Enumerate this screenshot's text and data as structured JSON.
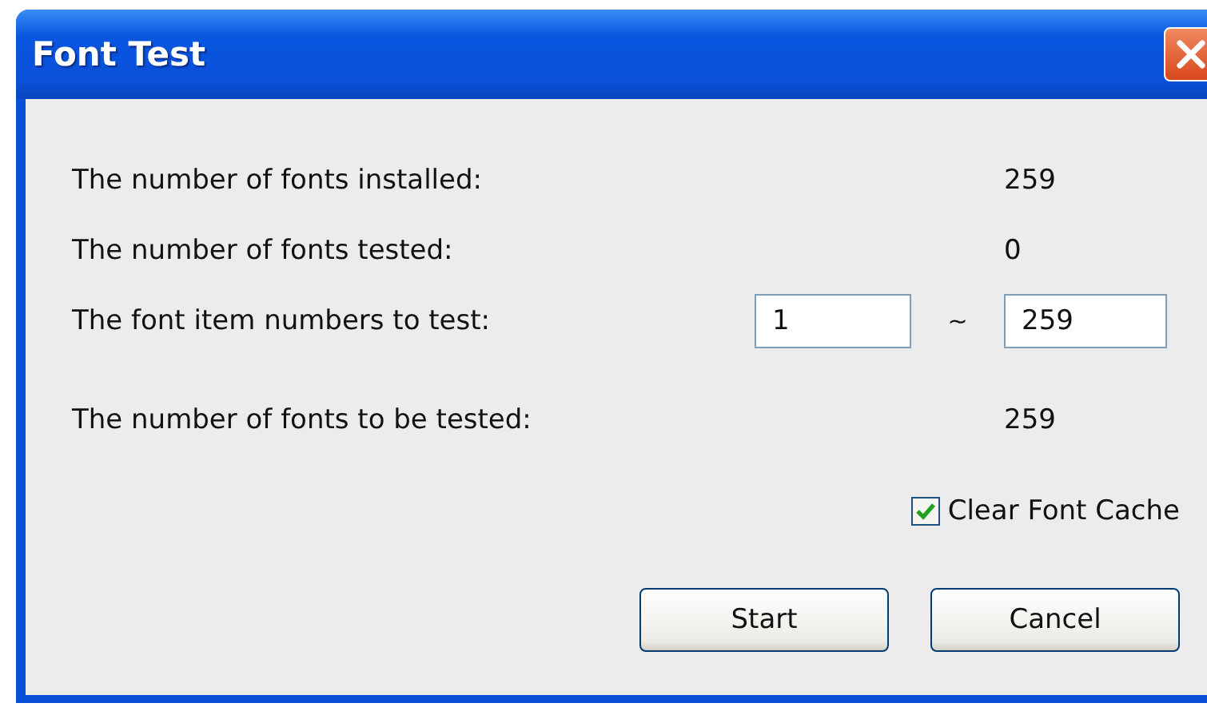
{
  "window": {
    "title": "Font Test"
  },
  "rows": [
    {
      "kind": "value",
      "label": "The number of fonts installed:",
      "value": "259"
    },
    {
      "kind": "value",
      "label": "The number of fonts tested:",
      "value": "0"
    },
    {
      "kind": "range",
      "label": "The font item numbers to test:",
      "from": "1",
      "separator": "~",
      "to": "259"
    },
    {
      "kind": "value",
      "label": "The number of fonts to be tested:",
      "value": "259"
    }
  ],
  "checkbox": {
    "label": "Clear Font Cache",
    "checked": true
  },
  "buttons": [
    {
      "label": "Start"
    },
    {
      "label": "Cancel"
    }
  ]
}
